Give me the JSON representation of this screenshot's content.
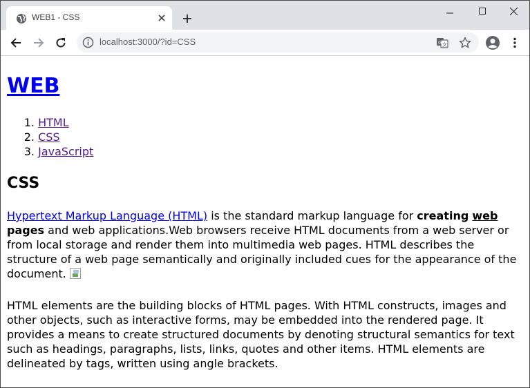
{
  "browser": {
    "tab_title": "WEB1 - CSS",
    "url": "localhost:3000/?id=CSS"
  },
  "page": {
    "site_title": "WEB",
    "nav": [
      {
        "num": "1.",
        "label": "HTML"
      },
      {
        "num": "2.",
        "label": "CSS"
      },
      {
        "num": "3.",
        "label": "JavaScript"
      }
    ],
    "heading": "CSS",
    "p1": {
      "link": "Hypertext Markup Language (HTML)",
      "text1": " is the standard markup language for ",
      "bold1": "creating",
      "sp1": " ",
      "bold_link": "web",
      "sp2": " ",
      "bold2": "pages",
      "text2": " and web applications.Web browsers receive HTML documents from a web server or from local storage and render them into multimedia web pages. HTML describes the structure of a web page semantically and originally included cues for the appearance of the document. "
    },
    "p2": "HTML elements are the building blocks of HTML pages. With HTML constructs, images and other objects, such as interactive forms, may be embedded into the rendered page. It provides a means to create structured documents by denoting structural semantics for text such as headings, paragraphs, lists, links, quotes and other items. HTML elements are delineated by tags, written using angle brackets."
  },
  "icons": {
    "favicon": "globe-icon",
    "close": "close-icon",
    "new_tab": "plus-icon",
    "minimize": "minimize-icon",
    "maximize": "maximize-icon",
    "window_close": "window-close-icon",
    "back": "back-arrow-icon",
    "forward": "forward-arrow-icon",
    "reload": "reload-icon",
    "info": "info-icon",
    "translate": "translate-icon",
    "bookmark": "star-icon",
    "profile": "account-icon",
    "menu": "more-vert-icon"
  },
  "colors": {
    "link": "#0000ee",
    "visited_link": "#551a8b",
    "tabstrip": "#dee1e6",
    "omnibox": "#f1f3f4"
  }
}
